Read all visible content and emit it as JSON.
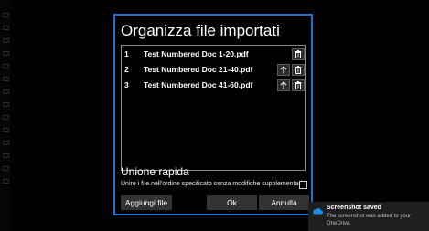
{
  "dialog": {
    "title": "Organizza file importati",
    "files": [
      {
        "index": "1",
        "name": "Test Numbered Doc 1-20.pdf",
        "can_move_up": false
      },
      {
        "index": "2",
        "name": "Test Numbered Doc 21-40.pdf",
        "can_move_up": true
      },
      {
        "index": "3",
        "name": "Test Numbered Doc 41-60.pdf",
        "can_move_up": true
      }
    ],
    "quick_merge": {
      "title": "Unione rapida",
      "label": "Unire i file nell'ordine specificato senza modifiche supplementari?",
      "checked": false
    },
    "buttons": {
      "add": "Aggiungi file",
      "ok": "Ok",
      "cancel": "Annulla"
    }
  },
  "toast": {
    "title": "Screenshot saved",
    "body": "The screenshot was added to your OneDrive.",
    "icon": "onedrive-cloud-icon"
  },
  "colors": {
    "accent_border": "#1a74d9",
    "background": "#000000",
    "button": "#333333",
    "toast_bg": "#1f1f1f",
    "cloud": "#1e8be8"
  }
}
